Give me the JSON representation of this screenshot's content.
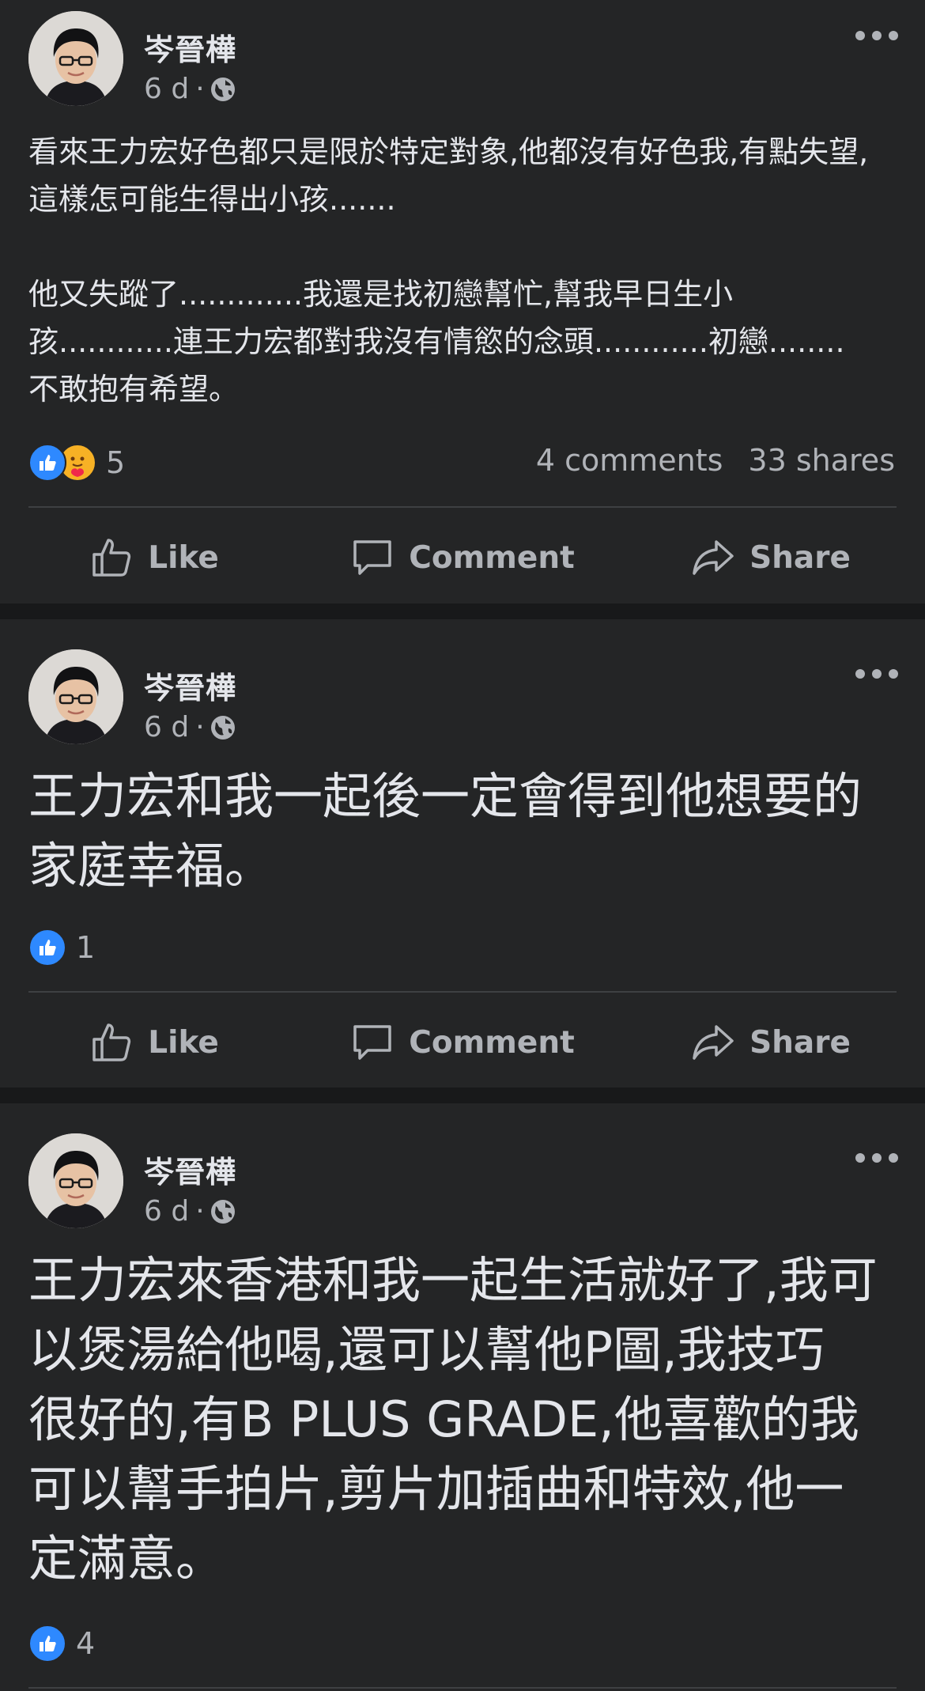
{
  "posts": [
    {
      "author": "岑晉樺",
      "time": "6 d",
      "separator": "·",
      "audience_icon": "globe-icon",
      "text": "看來王力宏好色都只是限於特定對象,他都沒有好色我,有點失望,\n這樣怎可能生得出小孩.......\n\n他又失蹤了.............我還是找初戀幫忙,幫我早日生小\n孩............連王力宏都對我沒有情慾的念頭............初戀........\n不敢抱有希望。",
      "reaction_icons": [
        "like-icon",
        "care-icon"
      ],
      "reaction_count": "5",
      "comments": "4 comments",
      "shares": "33 shares"
    },
    {
      "author": "岑晉樺",
      "time": "6 d",
      "separator": "·",
      "audience_icon": "globe-icon",
      "text": "王力宏和我一起後一定會得到他想要的\n家庭幸福。",
      "reaction_icons": [
        "like-icon"
      ],
      "reaction_count": "1"
    },
    {
      "author": "岑晉樺",
      "time": "6 d",
      "separator": "·",
      "audience_icon": "globe-icon",
      "text": "王力宏來香港和我一起生活就好了,我可\n以煲湯給他喝,還可以幫他P圖,我技巧\n很好的,有B PLUS GRADE,他喜歡的我\n可以幫手拍片,剪片加插曲和特效,他一\n定滿意。",
      "reaction_icons": [
        "like-icon"
      ],
      "reaction_count": "4"
    }
  ],
  "actions": {
    "like": "Like",
    "comment": "Comment",
    "share": "Share"
  },
  "colors": {
    "page_background": "#18191a",
    "card_background": "#242526",
    "primary_text": "#e4e6eb",
    "secondary_text": "#b0b3b8",
    "like_blue": "#2e89ff",
    "care_yellow": "#f7b125"
  }
}
